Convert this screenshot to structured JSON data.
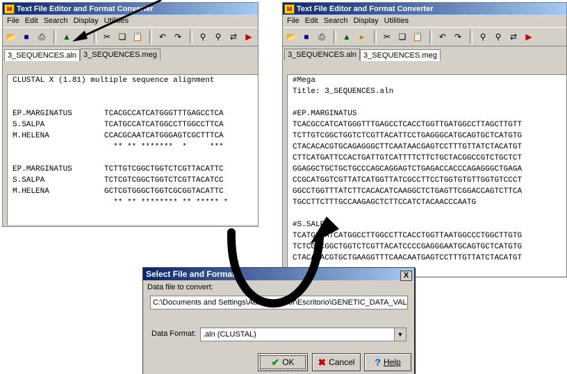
{
  "left_window": {
    "title": "Text File Editor and Format Converter",
    "menu": [
      "File",
      "Edit",
      "Search",
      "Display",
      "Utilities"
    ],
    "tabs": [
      "3_SEQUENCES.aln",
      "3_SEQUENCES.meg"
    ],
    "content": "CLUSTAL X (1.81) multiple sequence alignment\n\n\nEP.MARGINATUS       TCACGCCATCATGGGTTTGAGCCTCA\nS.SALPA             TCATGCCATCATGGCCTTGGCCTTCA\nM.HELENA            CCACGCAATCATGGGAGTCGCTTTCA\n                      ** ** *******  *     ***\n\nEP.MARGINATUS       TCTTGTCGGCTGGTCTCGTTACATTC\nS.SALPA             TCTCGTCGGCTGGTCTCGTTACATCC\nM.HELENA            GCTCGTGGGCTGGTCGCGGTACATTC\n                      ** ** ******** ** ***** *"
  },
  "right_window": {
    "title": "Text File Editor and Format Converter",
    "menu": [
      "File",
      "Edit",
      "Search",
      "Display",
      "Utilities"
    ],
    "tabs": [
      "3_SEQUENCES.aln",
      "3_SEQUENCES.meg"
    ],
    "content": "#Mega\nTitle: 3_SEQUENCES.aln\n\n#EP.MARGINATUS\nTCACGCCATCATGGGTTTGAGCCTCACCTGGTTGATGGCCTTAGCTTGTT\nTCTTGTCGGCTGGTCTCGTTACATTCCTGAGGGCATGCAGTGCTCATGTG\nCTACACACGTGCAGAGGGCTTCAATAACGAGTCCTTTGTTATCTACATGT\nCTTCATGATTCCACTGATTGTCATTTTCTTCTGCTACGGCCGTCTGCTCT\nGGAGGCTGCTGCTGCCCAGCAGGAGTCTGAGACCACCCAGAGGGCTGAGA\nCCGCATGGTCGTTATCATGGTTATCGCCTTCCTGGTGTGTTGGTGTCCCT\nGGCCTGGTTTATCTTCACACATCAAGGCTCTGAGTTCGGACCAGTCTTCA\nTGCCTTCTTTGCCAAGAGCTCTTCCATCTACAACCCAATG\n\n#S.SALPA\nTCATGCCATCATGGCCTTGGCCTTCACCTGGTTAATGGCCCTGGCTTGTG\nTCTCGTCGGCTGGTCTCGTTACATCCCCGAGGGAATGCAGTGCTCATGTG\nCTACACACGTGCTGAAGGTTTCAACAATGAGTCCTTTGTTATCTACATGT"
  },
  "dialog": {
    "title": "Select File and Format",
    "file_label": "Data file to convert:",
    "file_value": "C:\\Documents and Settings\\Administrador\\Escritorio\\GENETIC_DATA_VAL",
    "format_label": "Data Format:",
    "format_value": ".aln    (CLUSTAL)",
    "ok": "OK",
    "cancel": "Cancel",
    "help": "Help",
    "close": "X"
  },
  "icons": [
    "folder-open-icon",
    "save-icon",
    "print-icon",
    "convert-icon",
    "open-selected-icon",
    "cut-icon",
    "copy-icon",
    "paste-icon",
    "undo-icon",
    "redo-icon",
    "find-icon",
    "find-next-icon",
    "replace-icon",
    "run-icon"
  ],
  "colors": {
    "title_start": "#0a246a",
    "title_end": "#a6caf0",
    "arrow": "#000000"
  }
}
